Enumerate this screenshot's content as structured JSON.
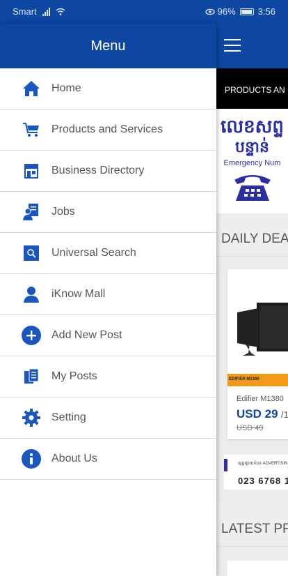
{
  "status_bar": {
    "carrier": "Smart",
    "battery_percent": "96%",
    "time": "3:56"
  },
  "drawer": {
    "title": "Menu",
    "items": [
      {
        "label": "Home",
        "icon": "home-icon"
      },
      {
        "label": "Products and Services",
        "icon": "cart-icon"
      },
      {
        "label": "Business Directory",
        "icon": "store-icon"
      },
      {
        "label": "Jobs",
        "icon": "job-icon"
      },
      {
        "label": "Universal Search",
        "icon": "search-icon"
      },
      {
        "label": "iKnow Mall",
        "icon": "person-icon"
      },
      {
        "label": "Add New Post",
        "icon": "add-icon"
      },
      {
        "label": "My Posts",
        "icon": "posts-icon"
      },
      {
        "label": "Setting",
        "icon": "gear-icon"
      },
      {
        "label": "About Us",
        "icon": "info-icon"
      }
    ]
  },
  "background": {
    "strip_text": "PRODUCTS AN",
    "banner_kh_line1": "លេខសព្ទ",
    "banner_kh_line2": "បន្ទាន់",
    "banner_en": "Emergency Num",
    "daily_deals_title": "DAILY DEA",
    "deal": {
      "strip": "EDIFIER M1380",
      "name": "Edifier M1380",
      "price": "USD 29",
      "price_suffix": "/1",
      "old_price": "USD 49"
    },
    "ad": {
      "small_text": "ផ្សព្វផ្សាយទំនេរ ADVERTISING AVAIL",
      "phone": "023 6768 1"
    },
    "latest_title": "LATEST PF"
  },
  "colors": {
    "primary": "#0d47a1",
    "icon_blue": "#1a56c0",
    "deal_strip": "#f19a1a"
  }
}
